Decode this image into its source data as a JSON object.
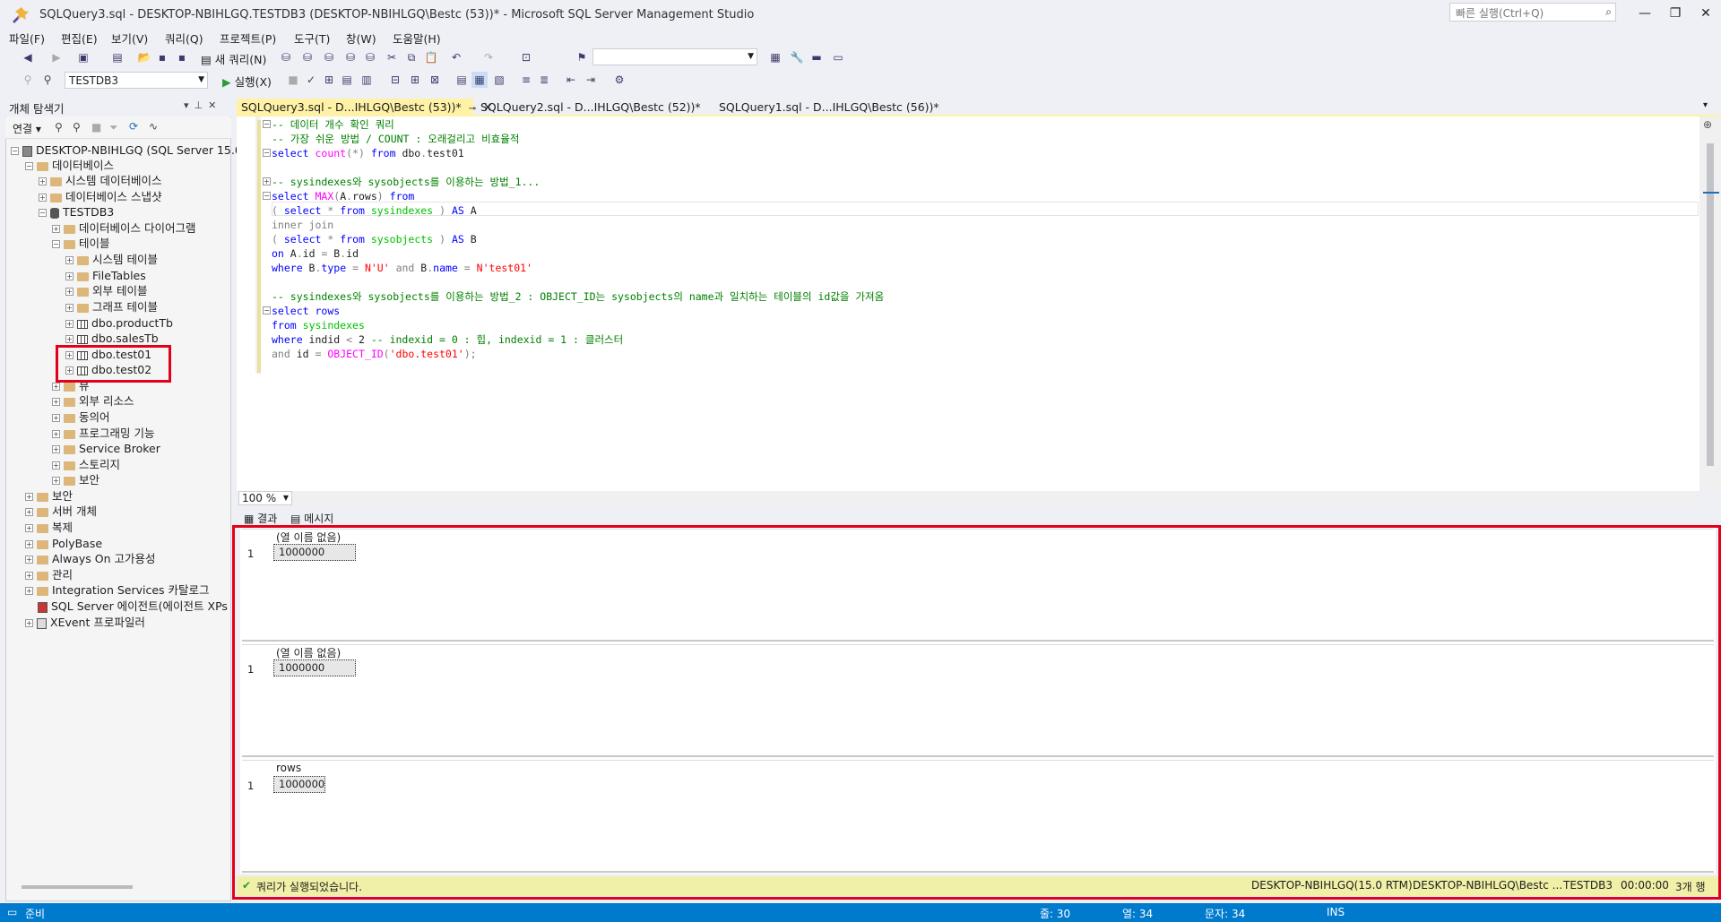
{
  "window": {
    "title": "SQLQuery3.sql - DESKTOP-NBIHLGQ.TESTDB3 (DESKTOP-NBIHLGQ\\Bestc (53))* - Microsoft SQL Server Management Studio",
    "quick_launch_placeholder": "빠른 실행(Ctrl+Q)"
  },
  "menu": [
    "파일(F)",
    "편집(E)",
    "보기(V)",
    "쿼리(Q)",
    "프로젝트(P)",
    "도구(T)",
    "창(W)",
    "도움말(H)"
  ],
  "toolbar": {
    "new_query_label": "새 쿼리(N)",
    "database_select": "TESTDB3",
    "execute_label": "실행(X)"
  },
  "object_explorer": {
    "title": "개체 탐색기",
    "connect_label": "연결",
    "tree": [
      "DESKTOP-NBIHLGQ (SQL Server 15.0.20",
      "데이터베이스",
      "시스템 데이터베이스",
      "데이터베이스 스냅샷",
      "TESTDB3",
      "데이터베이스 다이어그램",
      "테이블",
      "시스템 테이블",
      "FileTables",
      "외부 테이블",
      "그래프 테이블",
      "dbo.productTb",
      "dbo.salesTb",
      "dbo.test01",
      "dbo.test02",
      "뷰",
      "외부 리소스",
      "동의어",
      "프로그래밍 기능",
      "Service Broker",
      "스토리지",
      "보안",
      "보안",
      "서버 개체",
      "복제",
      "PolyBase",
      "Always On 고가용성",
      "관리",
      "Integration Services 카탈로그",
      "SQL Server 에이전트(에이전트 XPs 사",
      "XEvent 프로파일러"
    ]
  },
  "tabs": [
    "SQLQuery3.sql - D...IHLGQ\\Bestc (53))*",
    "SQLQuery2.sql - D...IHLGQ\\Bestc (52))*",
    "SQLQuery1.sql - D...IHLGQ\\Bestc (56))*"
  ],
  "editor": {
    "zoom": "100 %",
    "lines": [
      "-- 데이터 개수 확인 쿼리",
      "-- 가장 쉬운 방법 / COUNT : 오래걸리고 비효율적",
      "select count(*) from dbo.test01",
      "",
      "-- sysindexes와 sysobjects를 이용하는 방법_1...",
      "select MAX(A.rows) from",
      "( select * from sysindexes ) AS A",
      "inner join",
      "( select * from sysobjects ) AS B",
      "on A.id = B.id",
      "where B.type = N'U' and B.name = N'test01'",
      "",
      "-- sysindexes와 sysobjects를 이용하는 방법_2 : OBJECT_ID는 sysobjects의 name과 일치하는 테이블의 id값을 가져옴",
      "select rows",
      "from sysindexes",
      "where indid < 2 -- indexid = 0 : 힙, indexid = 1 : 클러스터",
      "and id = OBJECT_ID('dbo.test01');"
    ]
  },
  "results": {
    "tab_results": "결과",
    "tab_messages": "메시지",
    "grids": [
      {
        "column": "(열 이름 없음)",
        "row": "1",
        "value": "1000000"
      },
      {
        "column": "(열 이름 없음)",
        "row": "1",
        "value": "1000000"
      },
      {
        "column": "rows",
        "row": "1",
        "value": "1000000"
      }
    ]
  },
  "query_status": {
    "message": "쿼리가 실행되었습니다.",
    "server": "DESKTOP-NBIHLGQ(15.0 RTM)",
    "user": "DESKTOP-NBIHLGQ\\Bestc ...",
    "database": "TESTDB3",
    "elapsed": "00:00:00",
    "rows": "3개 행"
  },
  "status_bar": {
    "ready": "준비",
    "line": "줄: 30",
    "col": "열: 34",
    "ch": "문자: 34",
    "mode": "INS"
  },
  "colors": {
    "accent": "#007acc",
    "active_tab": "#fff1a6",
    "highlight_box": "#e3001b",
    "status_query": "#f0f0a8"
  }
}
